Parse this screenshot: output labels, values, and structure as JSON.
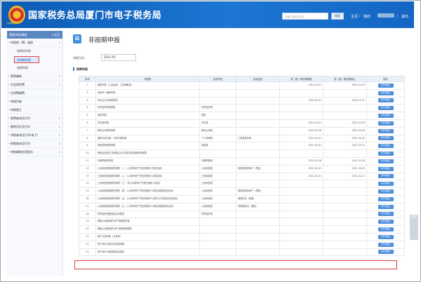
{
  "header": {
    "site_title": "国家税务总局厦门市电子税务局",
    "logo_text": "中国税务",
    "search_placeholder": "请输入搜索关键字",
    "search_button": "搜索",
    "nav_home": "主页",
    "nav_my": "我的",
    "nav_exit": "退出",
    "nav_sep": "|"
  },
  "sidebar": {
    "head_label": "我要申报/缴纳",
    "head_right": "◂ 主页",
    "items": [
      {
        "label": "申报税（费）清册",
        "chev": "∧"
      },
      {
        "label": "按期应申报",
        "sub": true
      },
      {
        "label": "非按期申报",
        "selected": true
      },
      {
        "label": "逾期申报",
        "sub": true
      },
      {
        "label": "税费缴纳",
        "chev": "∨"
      },
      {
        "label": "社会保险费",
        "chev": "∨"
      },
      {
        "label": "社保费缴费",
        "chev": ""
      },
      {
        "label": "申报作废",
        "chev": ""
      },
      {
        "label": "申报更正",
        "chev": ""
      },
      {
        "label": "税费查询及打印",
        "chev": "∨"
      },
      {
        "label": "缴款凭证及打印",
        "chev": "∨"
      },
      {
        "label": "申报查询及打印(电子)",
        "chev": "∨"
      },
      {
        "label": "财报查询及打印",
        "chev": "∨"
      },
      {
        "label": "申报辅助信息报告",
        "chev": "∨"
      }
    ]
  },
  "main": {
    "page_title": "非按期申报",
    "period_label": "申报月份：",
    "period_value": "2021-05",
    "section_label": "税费申报",
    "columns": [
      "序号",
      "申报表",
      "征收项目",
      "征收品目",
      "税（费）款所属期起",
      "税（费）款所属期止",
      "操作"
    ],
    "action_label": "填写申报表",
    "rows": [
      [
        "1",
        "通用申报（工会经费，工会筹备金）",
        "",
        "",
        "2021-04-01",
        "2021-04-30"
      ],
      [
        "2",
        "自助代人通用申报",
        "",
        "",
        "",
        ""
      ],
      [
        "3",
        "外商企业年报申报表",
        "",
        "",
        "2020-05-01",
        "2020-12-31"
      ],
      [
        "4",
        "环境保护税申报表",
        "环境保护税",
        "",
        "",
        ""
      ],
      [
        "5",
        "契税申报",
        "契税",
        "",
        "",
        ""
      ],
      [
        "6",
        "印花税申报",
        "印花税",
        "",
        "2021-04-01",
        "2021-04-30"
      ],
      [
        "7",
        "耕地占用税申报表",
        "耕地占用税",
        "",
        "2021-05-28",
        "2021-05-28"
      ],
      [
        "8",
        "通用代扣代缴、代收代缴申报",
        "个人所得税",
        "工资薪金所得",
        "2021-04-01",
        "2021-04-30"
      ],
      [
        "9",
        "增值税预缴申报表",
        "增值税",
        "",
        "2021-05-01",
        "2021-05-31"
      ],
      [
        "10",
        "跨地区经营汇总纳税企业分支机构年度纳税申报表",
        "",
        "",
        "",
        ""
      ],
      [
        "11",
        "车辆购置税申报",
        "车辆购置税",
        "",
        "2021-05-28",
        "2021-05-28"
      ],
      [
        "12",
        "土地增值税纳税申报表（一）（从事房地产开发的纳税人预征适用）",
        "土地增值税",
        "其他类型房地产（预征）",
        "2021-04-01",
        "2021-04-30"
      ],
      [
        "13",
        "土地增值税纳税申报表（二）（从事房地产开发的纳税人清算适用）",
        "土地增值税",
        "",
        "2021-01-01",
        "2021-02-11"
      ],
      [
        "14",
        "土地增值税纳税申报表（三）（非从事房地产开发的纳税人适用）",
        "土地增值税",
        "",
        "",
        ""
      ],
      [
        "15",
        "土地增值税纳税申报表（四）（从事房地产开发的纳税人清算后尾盘销售适用）",
        "土地增值税",
        "其他类型房地产（尾盘）",
        "",
        ""
      ],
      [
        "16",
        "土地增值税纳税申报表（五）（从事房地产开发的纳税人清算方式为核定征收适用）",
        "土地增值税",
        "普通住宅（尾盘）",
        "",
        ""
      ],
      [
        "17",
        "土地增值税纳税申报表（六）（从事房地产开发的纳税人清算后尾盘销售适用）",
        "土地增值税",
        "非普通住宅（尾盘）",
        "",
        ""
      ],
      [
        "18",
        "环境保护税基础信息采集表",
        "环境保护税",
        "",
        "",
        ""
      ],
      [
        "19",
        "城镇土地使用税 房产税纳税申报",
        "",
        "",
        "",
        ""
      ],
      [
        "20",
        "城镇土地使用税 房产税税源明细表",
        "",
        "",
        "",
        ""
      ],
      [
        "21",
        "房产交易申报（存量房）",
        "",
        "",
        "",
        ""
      ],
      [
        "22",
        "财产和行为税合并纳税申报",
        "",
        "",
        "",
        ""
      ],
      [
        "23",
        "财产和行为税税源信息报告",
        "",
        "",
        "",
        ""
      ]
    ]
  },
  "float_btn": "返回"
}
